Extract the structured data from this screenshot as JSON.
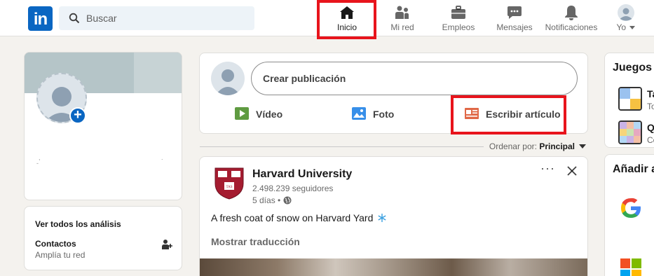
{
  "nav": {
    "logo_text": "in",
    "search_placeholder": "Buscar",
    "items": [
      {
        "label": "Inicio",
        "icon": "home-icon"
      },
      {
        "label": "Mi red",
        "icon": "network-icon"
      },
      {
        "label": "Empleos",
        "icon": "briefcase-icon"
      },
      {
        "label": "Mensajes",
        "icon": "messaging-icon"
      },
      {
        "label": "Notificaciones",
        "icon": "bell-icon"
      },
      {
        "label": "Yo",
        "icon": "avatar-icon"
      }
    ]
  },
  "profile": {
    "analytics_link": "Ver todos los análisis",
    "contacts_title": "Contactos",
    "contacts_sub": "Amplía tu red"
  },
  "share": {
    "start_post": "Crear publicación",
    "video": "Vídeo",
    "photo": "Foto",
    "article": "Escribir artículo"
  },
  "sort": {
    "label": "Ordenar por:",
    "value": "Principal"
  },
  "post": {
    "author": "Harvard University",
    "followers": "2.498.239 seguidores",
    "time": "5 días •",
    "body": "A fresh coat of snow on Harvard Yard",
    "translate": "Mostrar traducción"
  },
  "right": {
    "games_title": "Juegos d",
    "game1_letter": "Ta",
    "game1_sub": "To",
    "game2_letter": "Q",
    "game2_sub": "Co",
    "add_title": "Añadir a"
  },
  "colors": {
    "brand": "#0a66c2",
    "highlight": "#e8141c",
    "video_green": "#5f9b41",
    "photo_blue": "#378fe9",
    "article_orange": "#e06847"
  }
}
